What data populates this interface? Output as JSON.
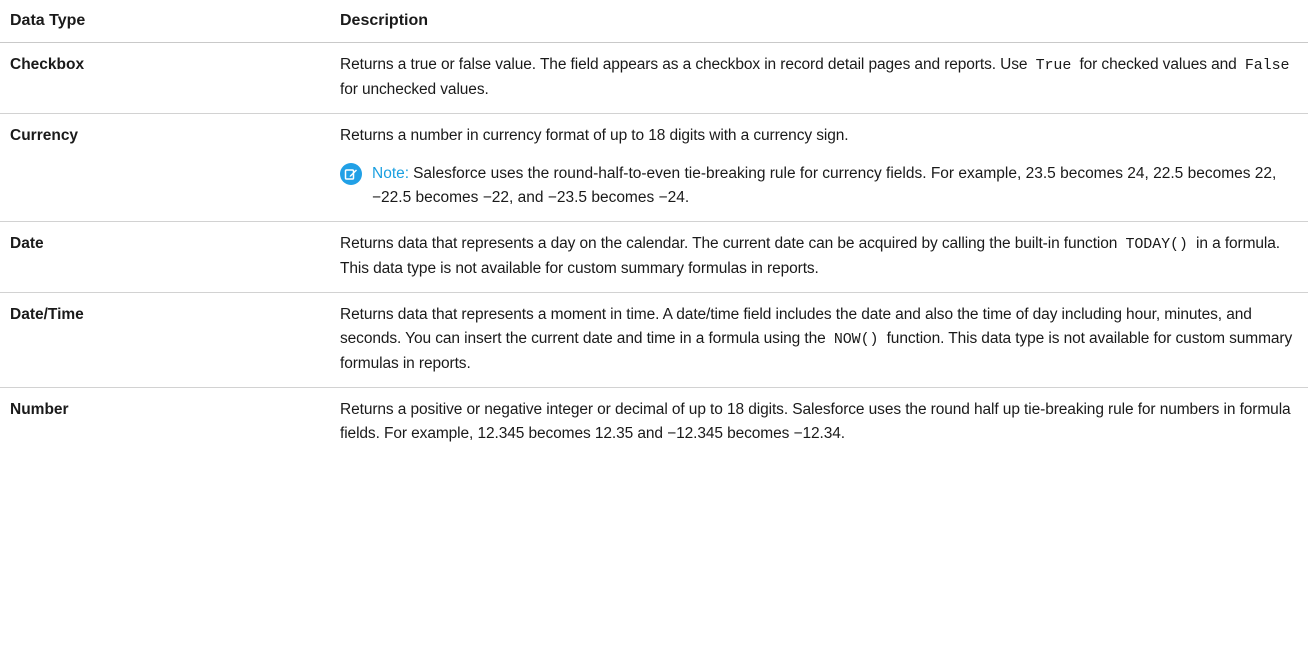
{
  "table": {
    "headers": {
      "type": "Data Type",
      "description": "Description"
    },
    "rows": [
      {
        "type": "Checkbox",
        "desc_parts": [
          "Returns a true or false value. The field appears as a checkbox in record detail pages and reports. Use ",
          "True",
          " for checked values and ",
          "False",
          " for unchecked values."
        ]
      },
      {
        "type": "Currency",
        "desc_parts": [
          "Returns a number in currency format of up to 18 digits with a currency sign."
        ],
        "note": {
          "label": "Note:",
          "text": "Salesforce uses the round-half-to-even tie-breaking rule for currency fields. For example, 23.5 becomes 24, 22.5 becomes 22, −22.5 becomes −22, and −23.5 becomes −24.",
          "icon": "edit-note-icon",
          "icon_color": "#21a0e6"
        }
      },
      {
        "type": "Date",
        "desc_parts": [
          "Returns data that represents a day on the calendar. The current date can be acquired by calling the built-in function ",
          "TODAY()",
          " in a formula. This data type is not available for custom summary formulas in reports."
        ]
      },
      {
        "type": "Date/Time",
        "desc_parts": [
          "Returns data that represents a moment in time. A date/time field includes the date and also the time of day including hour, minutes, and seconds. You can insert the current date and time in a formula using the ",
          "NOW()",
          " function. This data type is not available for custom summary formulas in reports."
        ]
      },
      {
        "type": "Number",
        "desc_parts": [
          "Returns a positive or negative integer or decimal of up to 18 digits. Salesforce uses the round half up tie-breaking rule for numbers in formula fields. For example, 12.345 becomes 12.35 and −12.345 becomes −12.34."
        ]
      }
    ]
  }
}
